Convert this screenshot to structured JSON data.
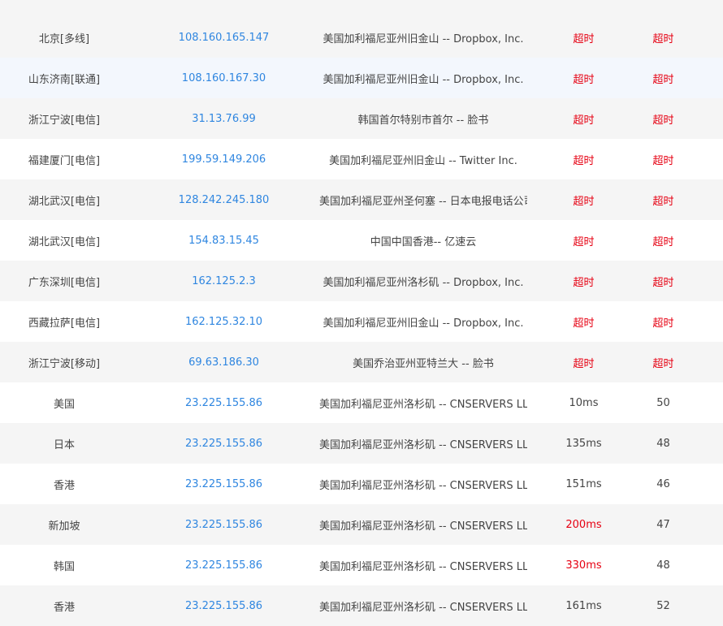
{
  "rows": [
    {
      "node": "",
      "ip": "",
      "location": "",
      "time": "",
      "ttl": "",
      "time_bad": false,
      "ttl_bad": false
    },
    {
      "node": "北京[多线]",
      "ip": "108.160.165.147",
      "location": "美国加利福尼亚州旧金山 -- Dropbox, Inc.",
      "time": "超时",
      "ttl": "超时",
      "time_bad": true,
      "ttl_bad": true
    },
    {
      "node": "山东济南[联通]",
      "ip": "108.160.167.30",
      "location": "美国加利福尼亚州旧金山 -- Dropbox, Inc.",
      "time": "超时",
      "ttl": "超时",
      "time_bad": true,
      "ttl_bad": true
    },
    {
      "node": "浙江宁波[电信]",
      "ip": "31.13.76.99",
      "location": "韩国首尔特别市首尔 -- 脸书",
      "time": "超时",
      "ttl": "超时",
      "time_bad": true,
      "ttl_bad": true
    },
    {
      "node": "福建厦门[电信]",
      "ip": "199.59.149.206",
      "location": "美国加利福尼亚州旧金山 -- Twitter Inc.",
      "time": "超时",
      "ttl": "超时",
      "time_bad": true,
      "ttl_bad": true
    },
    {
      "node": "湖北武汉[电信]",
      "ip": "128.242.245.180",
      "location": "美国加利福尼亚州圣何塞 -- 日本电报电话公司",
      "time": "超时",
      "ttl": "超时",
      "time_bad": true,
      "ttl_bad": true
    },
    {
      "node": "湖北武汉[电信]",
      "ip": "154.83.15.45",
      "location": "中国中国香港-- 亿速云",
      "time": "超时",
      "ttl": "超时",
      "time_bad": true,
      "ttl_bad": true
    },
    {
      "node": "广东深圳[电信]",
      "ip": "162.125.2.3",
      "location": "美国加利福尼亚州洛杉矶 -- Dropbox, Inc.",
      "time": "超时",
      "ttl": "超时",
      "time_bad": true,
      "ttl_bad": true
    },
    {
      "node": "西藏拉萨[电信]",
      "ip": "162.125.32.10",
      "location": "美国加利福尼亚州旧金山 -- Dropbox, Inc.",
      "time": "超时",
      "ttl": "超时",
      "time_bad": true,
      "ttl_bad": true
    },
    {
      "node": "浙江宁波[移动]",
      "ip": "69.63.186.30",
      "location": "美国乔治亚州亚特兰大 -- 脸书",
      "time": "超时",
      "ttl": "超时",
      "time_bad": true,
      "ttl_bad": true
    },
    {
      "node": "美国",
      "ip": "23.225.155.86",
      "location": "美国加利福尼亚州洛杉矶 -- CNSERVERS LLC",
      "time": "10ms",
      "ttl": "50",
      "time_bad": false,
      "ttl_bad": false
    },
    {
      "node": "日本",
      "ip": "23.225.155.86",
      "location": "美国加利福尼亚州洛杉矶 -- CNSERVERS LLC",
      "time": "135ms",
      "ttl": "48",
      "time_bad": false,
      "ttl_bad": false
    },
    {
      "node": "香港",
      "ip": "23.225.155.86",
      "location": "美国加利福尼亚州洛杉矶 -- CNSERVERS LLC",
      "time": "151ms",
      "ttl": "46",
      "time_bad": false,
      "ttl_bad": false
    },
    {
      "node": "新加坡",
      "ip": "23.225.155.86",
      "location": "美国加利福尼亚州洛杉矶 -- CNSERVERS LLC",
      "time": "200ms",
      "ttl": "47",
      "time_bad": true,
      "ttl_bad": false
    },
    {
      "node": "韩国",
      "ip": "23.225.155.86",
      "location": "美国加利福尼亚州洛杉矶 -- CNSERVERS LLC",
      "time": "330ms",
      "ttl": "48",
      "time_bad": true,
      "ttl_bad": false
    },
    {
      "node": "香港",
      "ip": "23.225.155.86",
      "location": "美国加利福尼亚州洛杉矶 -- CNSERVERS LLC",
      "time": "161ms",
      "ttl": "52",
      "time_bad": false,
      "ttl_bad": false
    }
  ],
  "colors": {
    "ip_link": "#2f86e0",
    "bad": "#e60012",
    "row_odd": "#f5f5f5",
    "row_even": "#ffffff",
    "row_highlight": "#f3f7fd"
  }
}
